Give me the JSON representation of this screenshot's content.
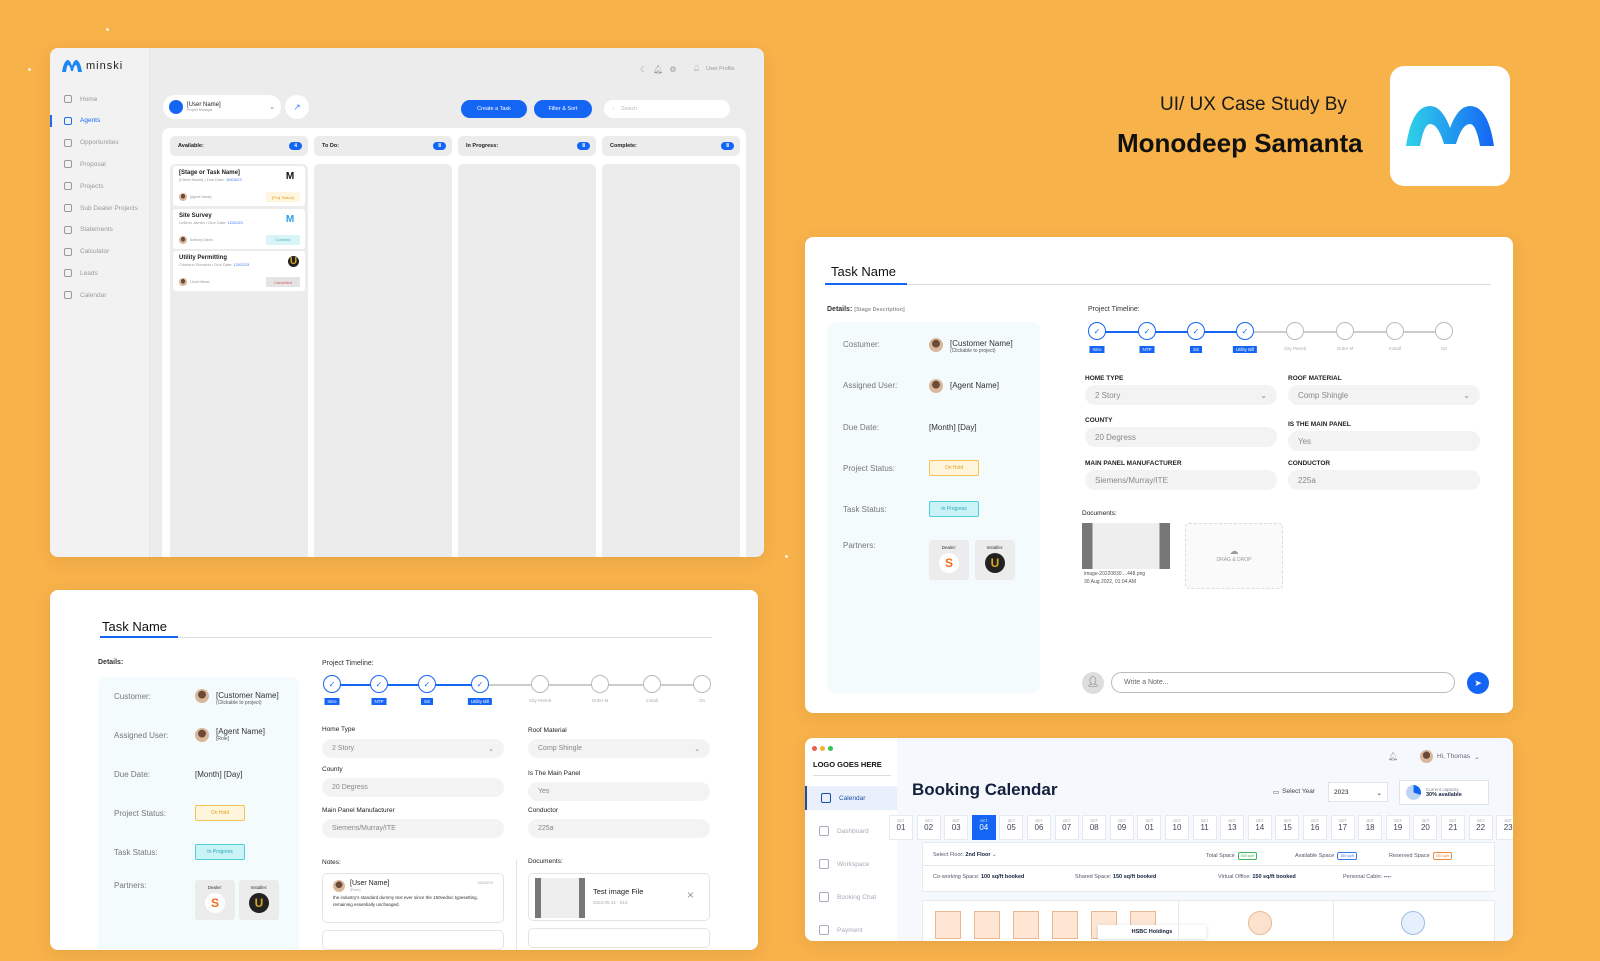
{
  "header": {
    "subtitle": "UI/ UX Case Study By",
    "author": "Monodeep Samanta"
  },
  "colors": {
    "background": "#F8B24A",
    "accent": "#1565F5"
  },
  "dashboard": {
    "brand": "minski",
    "nav": [
      {
        "label": "Home",
        "icon": "home-icon"
      },
      {
        "label": "Agents",
        "icon": "user-icon",
        "active": true
      },
      {
        "label": "Opportunities",
        "icon": "sun-icon"
      },
      {
        "label": "Proposal",
        "icon": "file-icon"
      },
      {
        "label": "Projects",
        "icon": "layers-icon"
      },
      {
        "label": "Sub Dealer Projects",
        "icon": "users-icon"
      },
      {
        "label": "Statements",
        "icon": "document-icon"
      },
      {
        "label": "Calculator",
        "icon": "calculator-icon"
      },
      {
        "label": "Leads",
        "icon": "filter-icon"
      },
      {
        "label": "Calendar",
        "icon": "calendar-icon"
      }
    ],
    "user_profile": "User Profile",
    "user_select": {
      "name": "[User Name]",
      "role": "Project Manager"
    },
    "create_task": "Create a Task",
    "filter_sort": "Filter & Sort",
    "search_placeholder": "Search",
    "columns": [
      {
        "title": "Available:",
        "count": "4"
      },
      {
        "title": "To Do:",
        "count": "8"
      },
      {
        "title": "In Progress:",
        "count": "8"
      },
      {
        "title": "Complete:",
        "count": "8"
      }
    ],
    "cards": [
      {
        "title": "[Stage or Task Name]",
        "client": "[Client Name]",
        "due_label": "Due Date:",
        "due": "10/03/23",
        "agent": "[Agent Name]",
        "status": "[Proj Status]",
        "status_style": "proj"
      },
      {
        "title": "Site Survey",
        "client": "LeBron James",
        "due_label": "Due Date:",
        "due": "12/02/21",
        "agent": "Anthony Davis",
        "status": "Contract",
        "status_style": "contract"
      },
      {
        "title": "Utility Permitting",
        "client": "Cristiano Ronaldo",
        "due_label": "Due Date:",
        "due": "12/02/23",
        "agent": "Lionel Messi",
        "status": "Cancelled",
        "status_style": "cancel"
      }
    ]
  },
  "task_right": {
    "title": "Task Name",
    "details_label": "Details:",
    "details_hint": "[Stage Description]",
    "rows": {
      "customer_label": "Costumer:",
      "customer": "[Customer Name]",
      "customer_hint": "(Clickable to project)",
      "assigned_label": "Assigned User:",
      "agent": "[Agent Name]",
      "due_label": "Due Date:",
      "due": "[Month] [Day]",
      "project_status_label": "Project Status:",
      "project_status": "On Hold",
      "task_status_label": "Task Status:",
      "task_status": "In Progress",
      "partners_label": "Partners:",
      "dealer": "Dealer:",
      "installer": "Installer:"
    },
    "timeline_label": "Project Timeline:",
    "form": {
      "home_type_label": "HOME TYPE",
      "home_type": "2 Story",
      "roof_label": "ROOF MATERIAL",
      "roof": "Comp Shingle",
      "county_label": "COUNTY",
      "county": "20 Degress",
      "main_panel_label": "IS THE MAIN PANEL",
      "main_panel": "Yes",
      "mpm_label": "MAIN PANEL MANUFACTURER",
      "mpm": "Siemens/Murray/ITE",
      "conductor_label": "CONDUCTOR",
      "conductor": "225a"
    },
    "documents_label": "Documents:",
    "doc_name": "image-20220830....448.png",
    "doc_date": "30 Aug 2022, 01:04 AM",
    "drag_drop": "DRAG & DROP",
    "note_placeholder": "Write a Note..."
  },
  "task_left": {
    "title": "Task Name",
    "details_label": "Details:",
    "rows": {
      "customer_label": "Customer:",
      "customer": "[Customer Name]",
      "customer_hint": "(Clickable to project)",
      "assigned_label": "Assigned User:",
      "agent": "[Agent Name]",
      "agent_role": "[Role]",
      "due_label": "Due Date:",
      "due": "[Month] [Day]",
      "project_status_label": "Project Status:",
      "project_status": "On Hold",
      "task_status_label": "Task Status:",
      "task_status": "In Progress",
      "partners_label": "Partners:",
      "dealer": "Dealer:",
      "installer": "Installer:"
    },
    "timeline_label": "Project Timeline:",
    "form": {
      "home_type_label": "Home Type",
      "home_type": "2 Story",
      "roof_label": "Roof Material",
      "roof": "Comp Shingle",
      "county_label": "County",
      "county": "20 Degress",
      "main_panel_label": "Is The Main Panel",
      "main_panel": "Yes",
      "mpm_label": "Main Panel Manufacturer",
      "mpm": "Siemens/Murray/ITE",
      "conductor_label": "Conductor",
      "conductor": "225a"
    },
    "notes_label": "Notes:",
    "note": {
      "user": "[User Name]",
      "role": "[Role]",
      "date": "05/20/23",
      "text": "the industry's standard dummy text ever since the 150vednic typesetting, remaining essentially unchanged."
    },
    "documents_label": "Documents:",
    "doc": {
      "name": "Test image File",
      "meta": "2023-05-31  ·  613"
    }
  },
  "timeline": [
    {
      "label": "Intro",
      "done": true
    },
    {
      "label": "NTP",
      "done": true
    },
    {
      "label": "SS",
      "done": true
    },
    {
      "label": "Utility Bill",
      "done": true
    },
    {
      "label": "City Permit",
      "done": false
    },
    {
      "label": "Order M",
      "done": false
    },
    {
      "label": "Install",
      "done": false
    },
    {
      "label": "On",
      "done": false
    }
  ],
  "booking": {
    "logo": "LOGO GOES HERE",
    "title": "Booking Calendar",
    "user": "Hi, Thomas",
    "nav": [
      {
        "label": "Calendar",
        "active": true
      },
      {
        "label": "Dashboard"
      },
      {
        "label": "Workspace"
      },
      {
        "label": "Booking Chat"
      },
      {
        "label": "Payment"
      }
    ],
    "select_year_label": "Select Year",
    "year": "2023",
    "capacity_label": "Current capacity",
    "capacity": "30% available",
    "capacity_fraction": 0.3,
    "month": "OCT",
    "dates": [
      "01",
      "02",
      "03",
      "04",
      "05",
      "06",
      "07",
      "08",
      "09",
      "01",
      "10",
      "11",
      "13",
      "14",
      "15",
      "16",
      "17",
      "18",
      "19",
      "20",
      "21",
      "22",
      "23"
    ],
    "selected_date": "04",
    "floor_label": "Select Floor:",
    "floor": "2nd Floor",
    "total_label": "Total Space",
    "total": "500 sq/ft",
    "available_label": "Available Space",
    "available": "150 sq/ft",
    "reserved_label": "Reserved Space",
    "reserved": "350 sq/ft",
    "cowork_label": "Co-working Space:",
    "cowork": "100 sq/ft booked",
    "shared_label": "Shared Space:",
    "shared": "150 sq/ft booked",
    "virtual_label": "Virtual Office:",
    "virtual": "150 sq/ft booked",
    "cabin_label": "Personal Cabin:",
    "cabin": "----",
    "room_label": "HSBC Holdings"
  }
}
